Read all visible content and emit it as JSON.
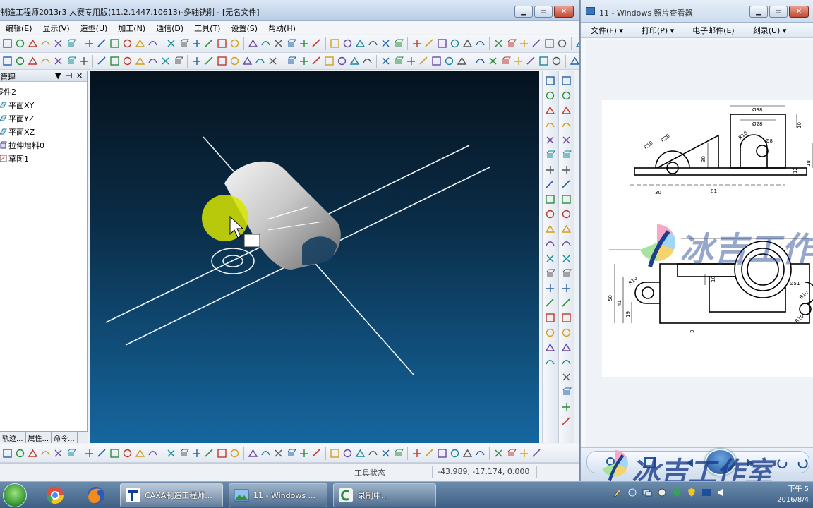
{
  "caxa": {
    "title": "制造工程师2013r3 大赛专用版(11.2.1447.10613)-多轴铣削 - [无名文件]",
    "menu": [
      "编辑(E)",
      "显示(V)",
      "造型(U)",
      "加工(N)",
      "通信(D)",
      "工具(T)",
      "设置(S)",
      "帮助(H)"
    ],
    "panel": {
      "title": "管理",
      "tree": [
        "零件2",
        "平面XY",
        "平面YZ",
        "平面XZ",
        "拉伸增料0",
        "草图1"
      ],
      "tabs": [
        "轨迹...",
        "属性...",
        "命令..."
      ]
    },
    "status": {
      "label": "工具状态",
      "coords": "-43.989, -17.174, 0.000"
    }
  },
  "viewer": {
    "title": "11 - Windows 照片查看器",
    "menu": [
      "文件(F) ▾",
      "打印(P) ▾",
      "电子邮件(E)",
      "刻录(U) ▾"
    ],
    "dims": {
      "d38": "Ø38",
      "d28": "Ø28",
      "r10a": "R10",
      "r20": "R20",
      "r10b": "R10",
      "d8": "Ø8",
      "v10": "10",
      "v30": "30",
      "v18": "18",
      "v12": "12",
      "h30": "30",
      "h81": "81",
      "v10b": "10",
      "v50": "50",
      "v41": "41",
      "v19": "19",
      "v3": "3",
      "r10c": "R10",
      "d51": "Ø51",
      "r10d": "R10",
      "r10e": "R10"
    },
    "watermark": "冰吉工作室"
  },
  "taskbar": {
    "tasks": [
      "CAXA制造工程师...",
      "11 - Windows ...",
      "录制中..."
    ],
    "time": "下午 5",
    "date": "2016/8/4"
  },
  "colors": {
    "viewport_top": "#06121e",
    "viewport_bottom": "#1567a0",
    "highlight": "#d7e400"
  }
}
